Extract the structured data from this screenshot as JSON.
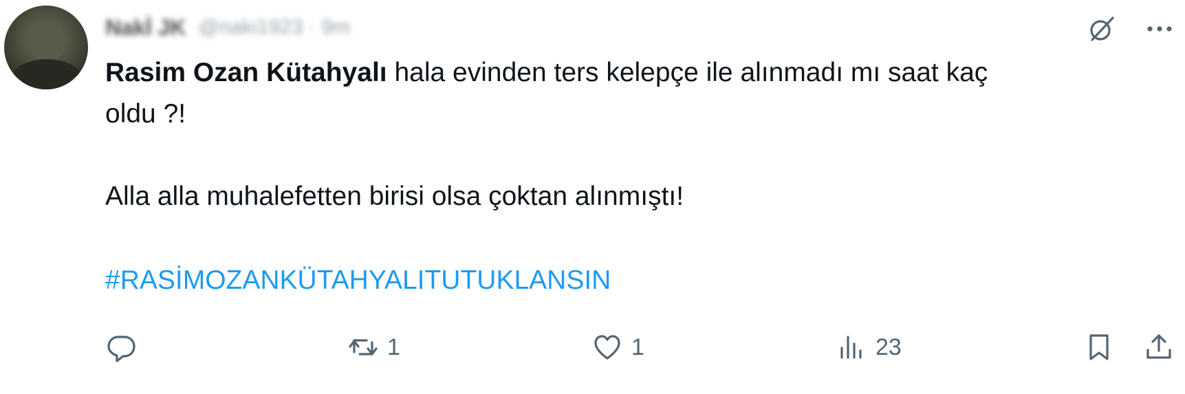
{
  "tweet": {
    "author_name": "Nakİ JK",
    "author_handle": "@naki1923 · 9m",
    "mention": "Rasim Ozan Kütahyalı",
    "line1_rest": " hala evinden ters kelepçe ile alınmadı mı saat kaç",
    "line2": "oldu ?!",
    "line3": "Alla alla muhalefetten birisi olsa çoktan alınmıştı!",
    "hashtag": "#RASİMOZANKÜTAHYALITUTUKLANSIN"
  },
  "actions": {
    "reply_count": "",
    "retweet_count": "1",
    "like_count": "1",
    "views_count": "23"
  },
  "icons": [
    "grok-icon",
    "more-icon",
    "reply-icon",
    "retweet-icon",
    "like-icon",
    "views-icon",
    "bookmark-icon",
    "share-icon"
  ],
  "colors": {
    "text": "#0f1419",
    "muted": "#536471",
    "link": "#1d9bf0",
    "background": "#ffffff"
  }
}
